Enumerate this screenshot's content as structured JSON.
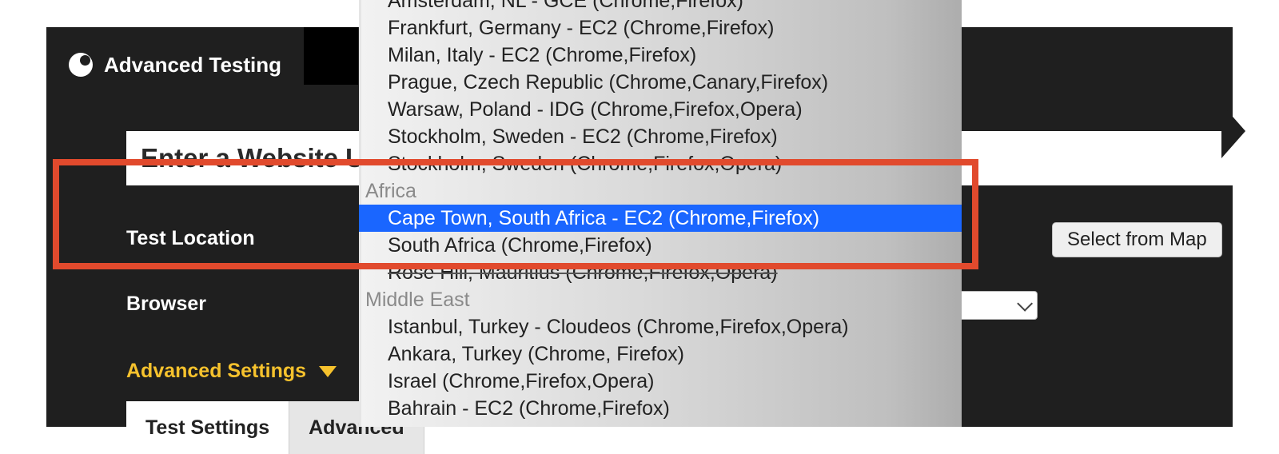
{
  "header": {
    "title": "Advanced Testing"
  },
  "url_field": {
    "placeholder": "Enter a Website URL"
  },
  "labels": {
    "test_location": "Test Location",
    "browser": "Browser",
    "advanced_settings": "Advanced Settings"
  },
  "buttons": {
    "select_from_map": "Select from Map"
  },
  "tabs": {
    "active": "Test Settings",
    "second": "Advanced"
  },
  "dropdown": {
    "partial_first": "Amsterdam, NL - GCE (Chrome,Firefox)",
    "items_europe": [
      "Frankfurt, Germany - EC2 (Chrome,Firefox)",
      "Milan, Italy - EC2 (Chrome,Firefox)",
      "Prague, Czech Republic (Chrome,Canary,Firefox)",
      "Warsaw, Poland - IDG (Chrome,Firefox,Opera)",
      "Stockholm, Sweden - EC2 (Chrome,Firefox)"
    ],
    "struck_item": "Stockholm, Sweden (Chrome,Firefox,Opera)",
    "group_a_label": "Africa",
    "group_a_items": [
      "Cape Town, South Africa - EC2 (Chrome,Firefox)",
      "South Africa (Chrome,Firefox)"
    ],
    "group_a_selected_index": 0,
    "after_africa_struck": "Rose Hill, Mauritius (Chrome,Firefox,Opera)",
    "group_b_label": "Middle East",
    "group_b_items": [
      "Istanbul, Turkey - Cloudeos (Chrome,Firefox,Opera)",
      "Ankara, Turkey (Chrome, Firefox)",
      "Israel (Chrome,Firefox,Opera)",
      "Bahrain - EC2 (Chrome,Firefox)"
    ]
  }
}
